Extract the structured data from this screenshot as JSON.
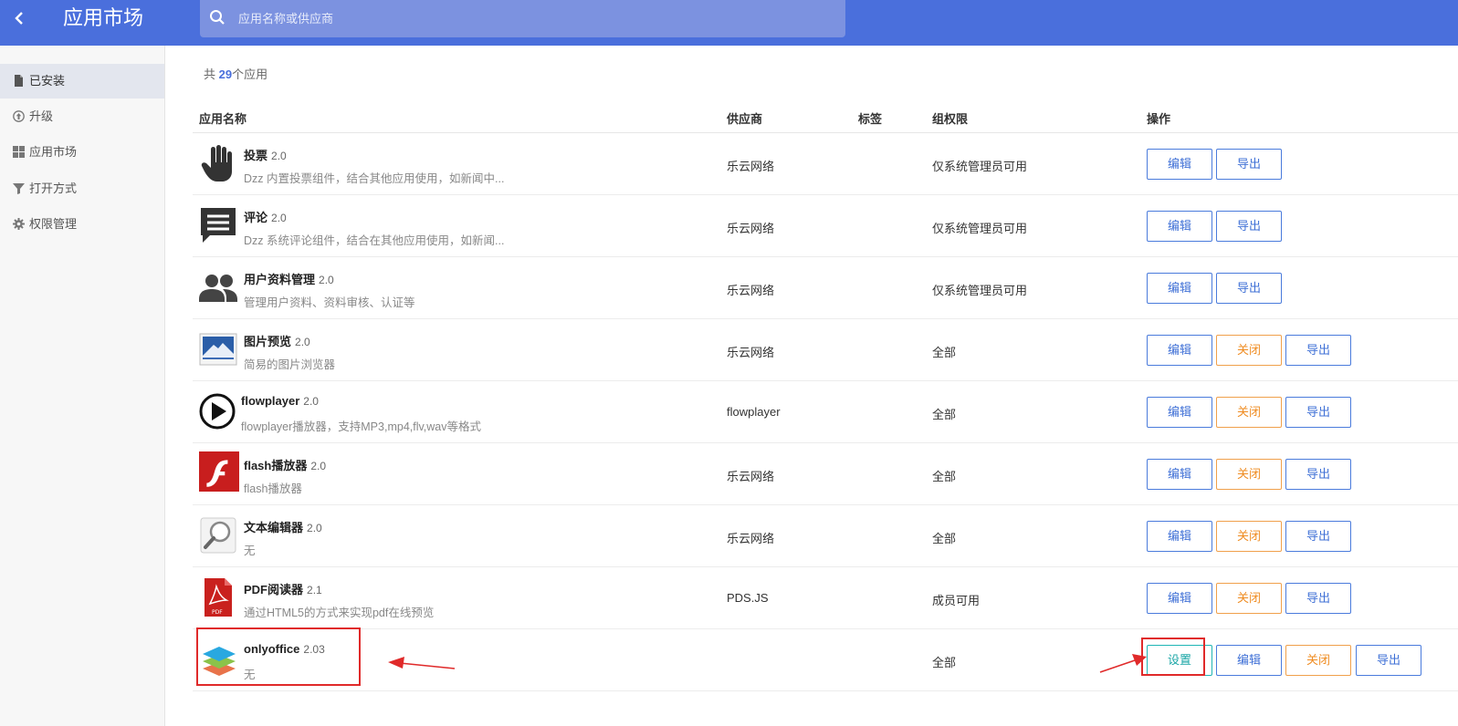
{
  "header": {
    "title": "应用市场",
    "search_placeholder": "应用名称或供应商"
  },
  "sidebar": {
    "items": [
      {
        "label": "已安装",
        "icon": "file-icon"
      },
      {
        "label": "升级",
        "icon": "upgrade-icon"
      },
      {
        "label": "应用市场",
        "icon": "grid-icon"
      },
      {
        "label": "打开方式",
        "icon": "filter-icon"
      },
      {
        "label": "权限管理",
        "icon": "gear-icon"
      }
    ]
  },
  "summary": {
    "prefix": "共",
    "count": "29",
    "suffix": "个应用"
  },
  "table": {
    "headers": {
      "name": "应用名称",
      "vendor": "供应商",
      "tag": "标签",
      "permission": "组权限",
      "actions": "操作"
    },
    "buttons": {
      "settings": "设置",
      "edit": "编辑",
      "close": "关闭",
      "export": "导出"
    },
    "rows": [
      {
        "name": "投票",
        "version": "2.0",
        "desc": "Dzz 内置投票组件，结合其他应用使用，如新闻中...",
        "vendor": "乐云网络",
        "permission": "仅系统管理员可用",
        "icon": "hand-icon"
      },
      {
        "name": "评论",
        "version": "2.0",
        "desc": "Dzz 系统评论组件，结合在其他应用使用，如新闻...",
        "vendor": "乐云网络",
        "permission": "仅系统管理员可用",
        "icon": "comment-icon"
      },
      {
        "name": "用户资料管理",
        "version": "2.0",
        "desc": "管理用户资料、资料审核、认证等",
        "vendor": "乐云网络",
        "permission": "仅系统管理员可用",
        "icon": "users-icon"
      },
      {
        "name": "图片预览",
        "version": "2.0",
        "desc": "简易的图片浏览器",
        "vendor": "乐云网络",
        "permission": "全部",
        "icon": "image-preview-icon"
      },
      {
        "name": "flowplayer",
        "version": "2.0",
        "desc": "flowplayer播放器，支持MP3,mp4,flv,wav等格式",
        "vendor": "flowplayer",
        "permission": "全部",
        "icon": "play-icon"
      },
      {
        "name": "flash播放器",
        "version": "2.0",
        "desc": "flash播放器",
        "vendor": "乐云网络",
        "permission": "全部",
        "icon": "flash-icon"
      },
      {
        "name": "文本编辑器",
        "version": "2.0",
        "desc": "无",
        "vendor": "乐云网络",
        "permission": "全部",
        "icon": "magnifier-icon"
      },
      {
        "name": "PDF阅读器",
        "version": "2.1",
        "desc": "通过HTML5的方式来实现pdf在线预览",
        "vendor": "PDS.JS",
        "permission": "成员可用",
        "icon": "pdf-icon"
      },
      {
        "name": "onlyoffice",
        "version": "2.03",
        "desc": "无",
        "vendor": "",
        "permission": "全部",
        "icon": "onlyoffice-icon"
      }
    ]
  },
  "colors": {
    "header_bg": "#4a6fdc",
    "accent": "#4a6fdc",
    "edit_border": "#4a7bdc",
    "close_border": "#f0a04b",
    "settings_border": "#1fb5b5",
    "annotation": "#e02a2a"
  }
}
